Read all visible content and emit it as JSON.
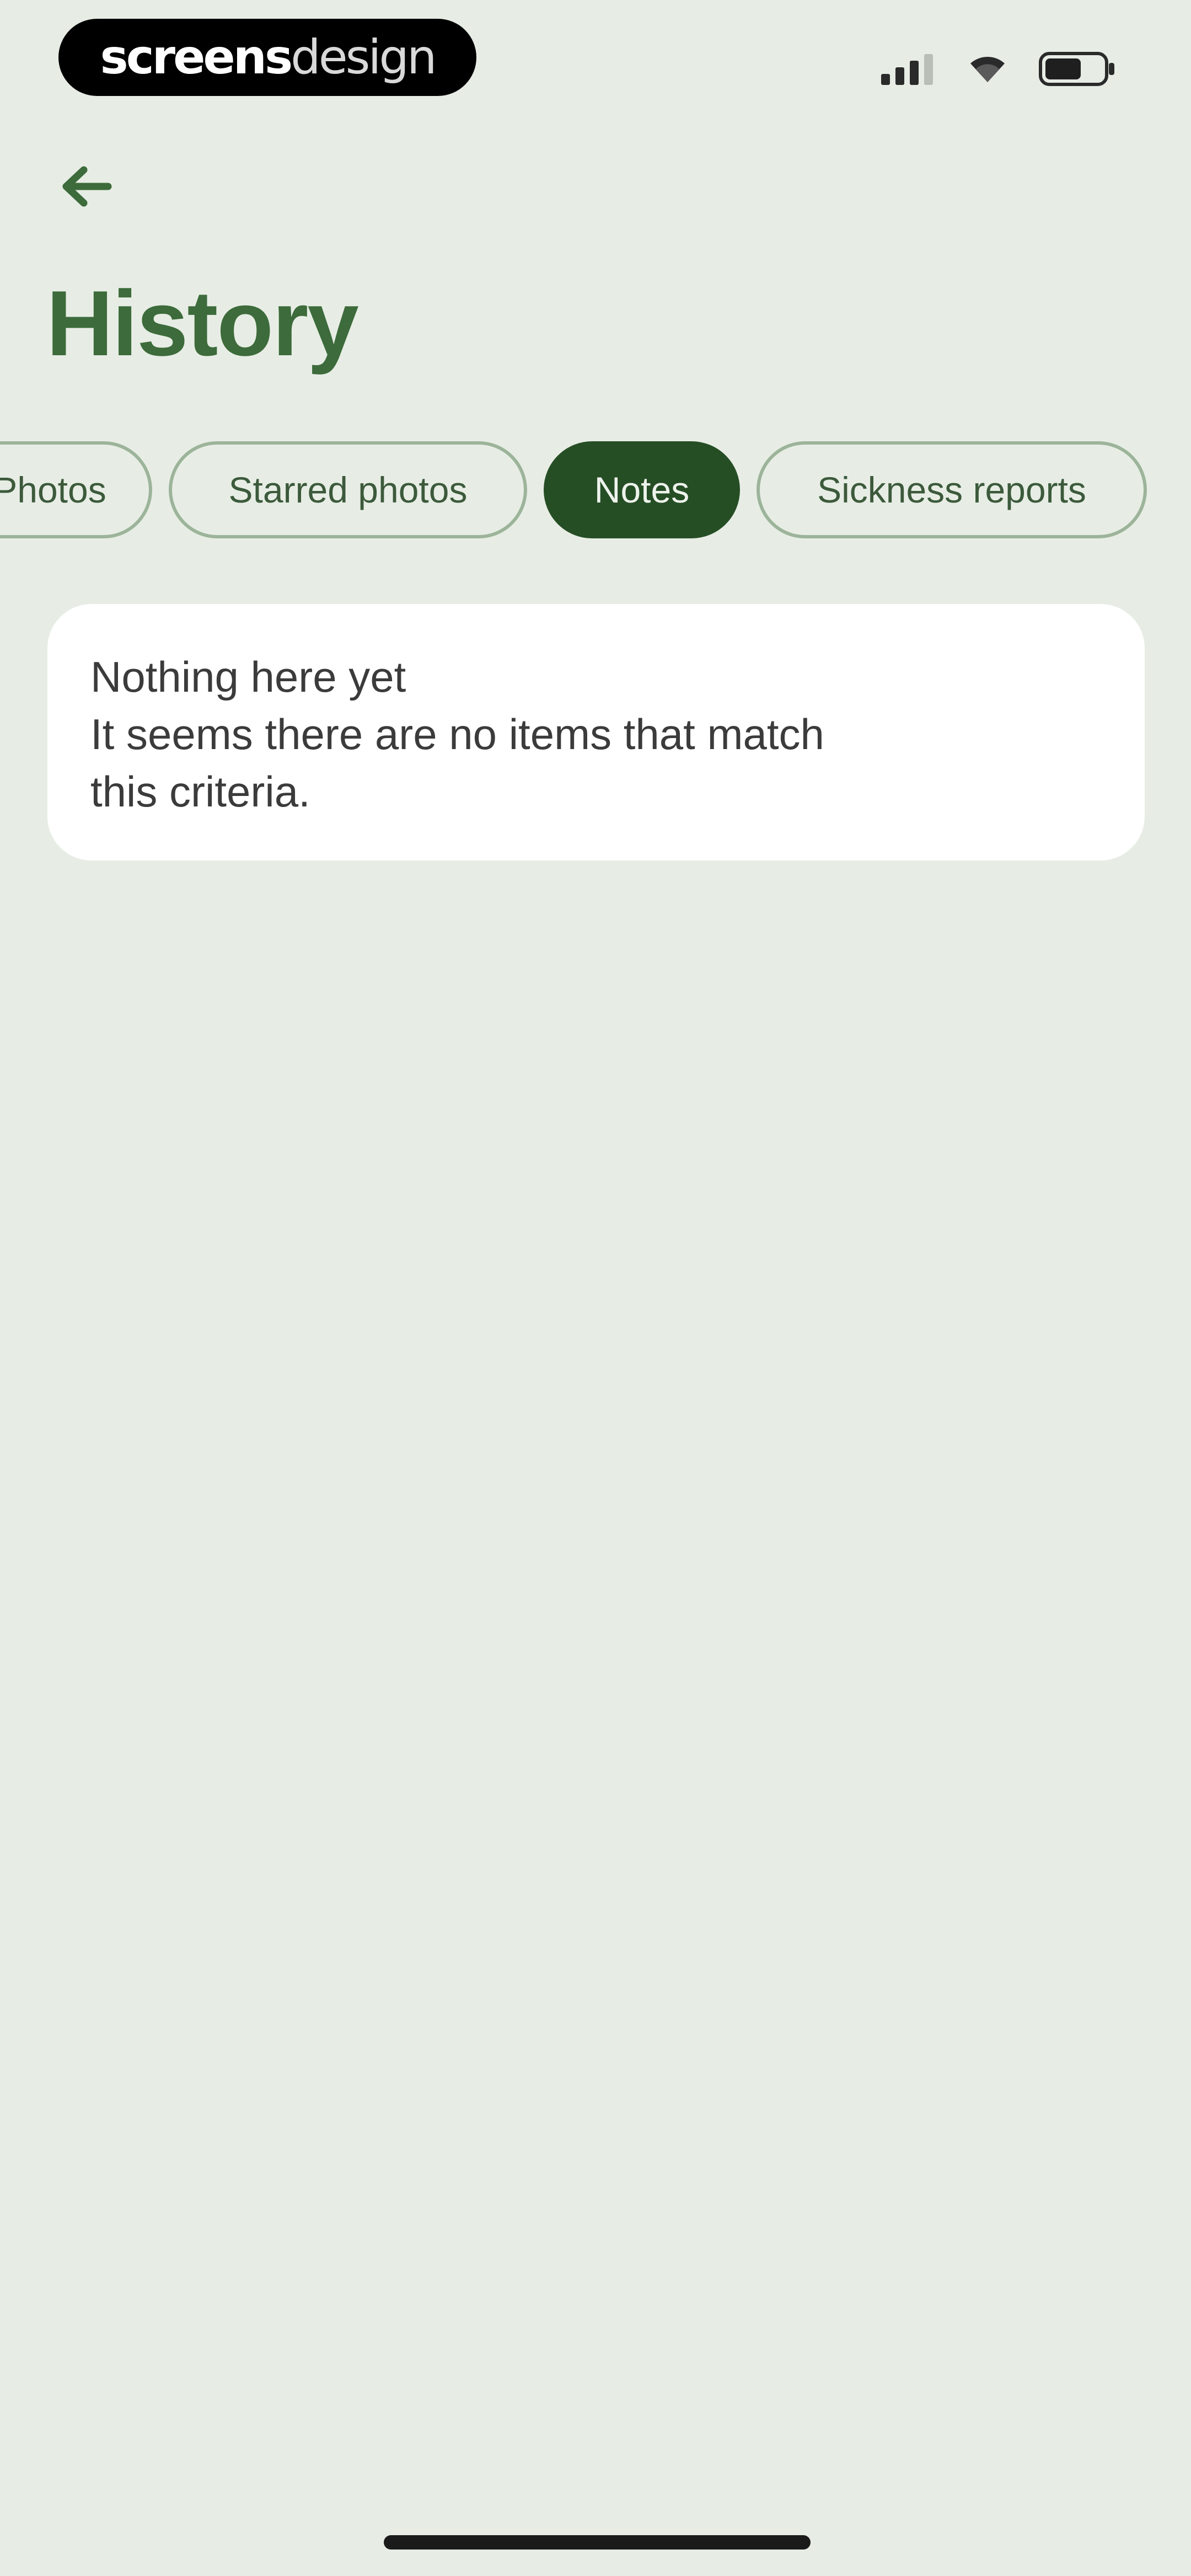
{
  "status_bar": {
    "brand_part1": "screens",
    "brand_part2": "design",
    "icons": [
      "signal-icon",
      "wifi-icon",
      "battery-icon"
    ]
  },
  "header": {
    "back_icon": "arrow-left-icon",
    "title": "History"
  },
  "tabs": [
    {
      "label": "Photos",
      "active": false
    },
    {
      "label": "Starred photos",
      "active": false
    },
    {
      "label": "Notes",
      "active": true
    },
    {
      "label": "Sickness reports",
      "active": false
    }
  ],
  "empty_state": {
    "title": "Nothing here yet",
    "message_line1": "It seems there are no items that match",
    "message_line2": "this criteria."
  },
  "colors": {
    "background": "#e7ede5",
    "accent_dark": "#264e25",
    "title_green": "#3d6b3b",
    "tab_border": "#9cb49a",
    "card_bg": "#ffffff"
  }
}
